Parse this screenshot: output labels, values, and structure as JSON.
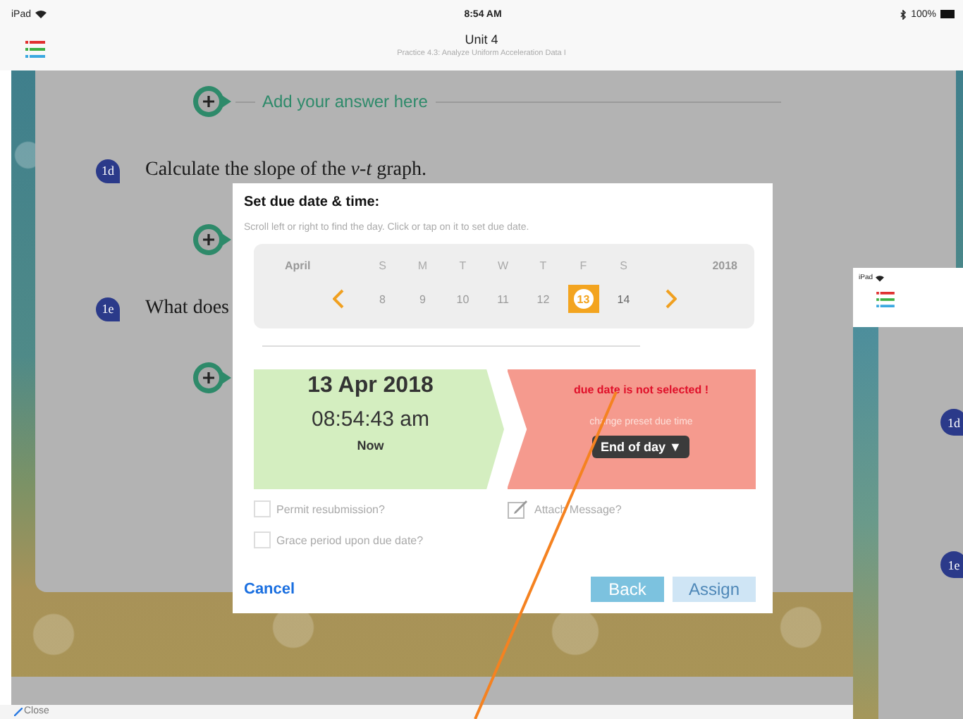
{
  "status_bar": {
    "device": "iPad",
    "time": "8:54 AM",
    "battery": "100%"
  },
  "nav_bar": {
    "title": "Unit 4",
    "subtitle": "Practice 4.3: Analyze Uniform Acceleration Data I"
  },
  "worksheet": {
    "items": [
      {
        "kind": "answer",
        "text": "Add your answer here"
      },
      {
        "kind": "question",
        "badge": "1d",
        "text": "Calculate the slope of the *v*-*t* graph."
      },
      {
        "kind": "answer"
      },
      {
        "kind": "question",
        "badge": "1e",
        "text": "What does"
      },
      {
        "kind": "answer"
      }
    ]
  },
  "due_dialog": {
    "title": "Set due date & time:",
    "hint": "Scroll left or right to find the day. Click or tap on it to set due date.",
    "calendar": {
      "month": "April",
      "year": "2018",
      "weekdays": [
        "S",
        "M",
        "T",
        "W",
        "T",
        "F",
        "S"
      ],
      "days": [
        {
          "label": "8",
          "selected": false,
          "disabled": true
        },
        {
          "label": "9",
          "selected": false,
          "disabled": true
        },
        {
          "label": "10",
          "selected": false,
          "disabled": true
        },
        {
          "label": "11",
          "selected": false,
          "disabled": true
        },
        {
          "label": "12",
          "selected": false,
          "disabled": true
        },
        {
          "label": "13",
          "selected": true,
          "disabled": false
        },
        {
          "label": "14",
          "selected": false,
          "disabled": false
        }
      ]
    },
    "start": {
      "date": "13 Apr 2018",
      "time": "08:54:43 am",
      "label": "Now"
    },
    "due": {
      "error": "due date is not selected !",
      "hint": "change preset due time",
      "preset": "End of day ▼"
    },
    "options": [
      {
        "kind": "checkbox",
        "label": "Permit resubmission?",
        "checked": false
      },
      {
        "kind": "message",
        "label": "Attach Message?"
      },
      {
        "kind": "checkbox",
        "label": "Grace period upon due date?",
        "checked": false
      }
    ],
    "cancel": "Cancel",
    "back": "Back",
    "assign": {
      "label": "Assign",
      "disabled": true
    }
  },
  "toolbar": {
    "close": "Close"
  },
  "second_screen": {
    "device": "iPad",
    "badges": [
      "1d",
      "1e"
    ]
  }
}
